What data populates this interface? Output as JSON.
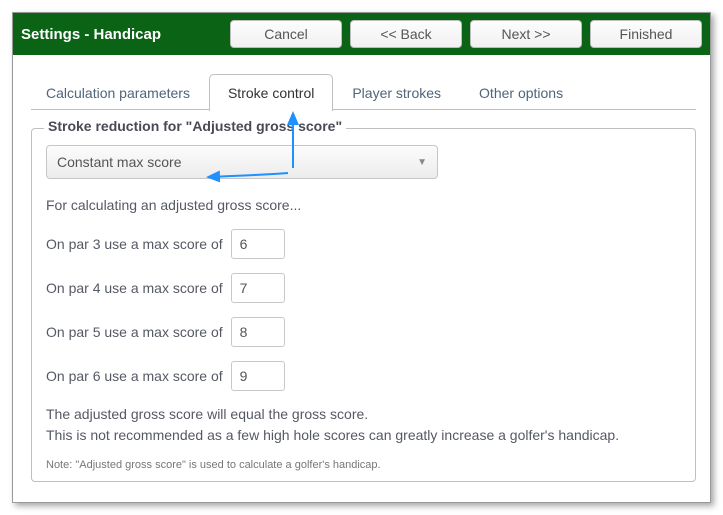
{
  "titlebar": {
    "title": "Settings - Handicap",
    "buttons": {
      "cancel": "Cancel",
      "back": "<< Back",
      "next": "Next >>",
      "finished": "Finished"
    }
  },
  "tabs": {
    "calc": "Calculation parameters",
    "stroke": "Stroke control",
    "player": "Player strokes",
    "other": "Other options"
  },
  "panel": {
    "legend": "Stroke reduction for \"Adjusted gross score\"",
    "dropdown_value": "Constant max score",
    "intro": "For calculating an adjusted gross score...",
    "rows": {
      "par3_label": "On par 3 use a max score of",
      "par3_value": "6",
      "par4_label": "On par 4 use a max score of",
      "par4_value": "7",
      "par5_label": "On par 5 use a max score of",
      "par5_value": "8",
      "par6_label": "On par 6 use a max score of",
      "par6_value": "9"
    },
    "foot_line1": "The adjusted gross score will equal the gross score.",
    "foot_line2": "This is not recommended as a few high hole scores can greatly increase a golfer's handicap.",
    "note": "Note: \"Adjusted gross score\" is used to calculate a golfer's handicap."
  }
}
